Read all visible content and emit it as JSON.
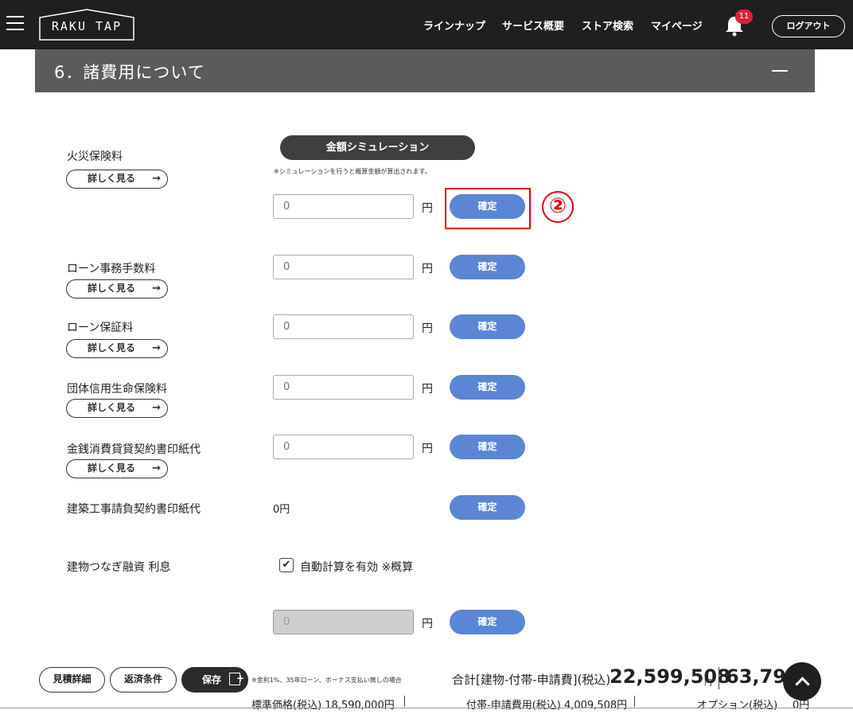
{
  "header": {
    "logo": "RAKU TAP",
    "nav": [
      "ラインナップ",
      "サービス概要",
      "ストア検索",
      "マイページ"
    ],
    "notification_count": "11",
    "logout_label": "ログアウト"
  },
  "section": {
    "title": "6．諸費用について"
  },
  "simulation": {
    "button_label": "金額シミュレーション",
    "note": "※シミュレーションを行うと概算金額が算出されます。"
  },
  "step_marker": "②",
  "common": {
    "more_label": "詳しく見る",
    "more_arrow": "→",
    "yen": "円",
    "confirm_label": "確定",
    "placeholder": "0"
  },
  "rows": {
    "fire_insurance": {
      "label": "火災保険料"
    },
    "loan_fee": {
      "label": "ローン事務手数料"
    },
    "loan_guarantee": {
      "label": "ローン保証料"
    },
    "group_insurance": {
      "label": "団体信用生命保険料"
    },
    "loan_stamp": {
      "label": "金銭消費貸貸契約書印紙代"
    },
    "construction_stamp": {
      "label": "建築工事請負契約書印紙代",
      "value": "0円"
    },
    "bridge_loan": {
      "label": "建物つなぎ融資 利息",
      "checkbox_label": "自動計算を有効 ※概算",
      "checked": true,
      "value": "0"
    }
  },
  "footer": {
    "estimate_detail": "見積詳細",
    "repayment_terms": "返済条件",
    "save": "保存",
    "footnote": "※金利1%、35年ローン、ボーナス支払い無しの場合",
    "total_label": "合計[建物-付帯-申請費](税込)",
    "total_value": "22,599,508",
    "total_unit": "円",
    "monthly_value": "63,795",
    "standard_price": "標準価格(税込) 18,590,000円",
    "ancillary_cost": "付帯-申請費用(税込) 4,009,508円",
    "option_label": "オプション(税込)",
    "option_value": "0円"
  }
}
